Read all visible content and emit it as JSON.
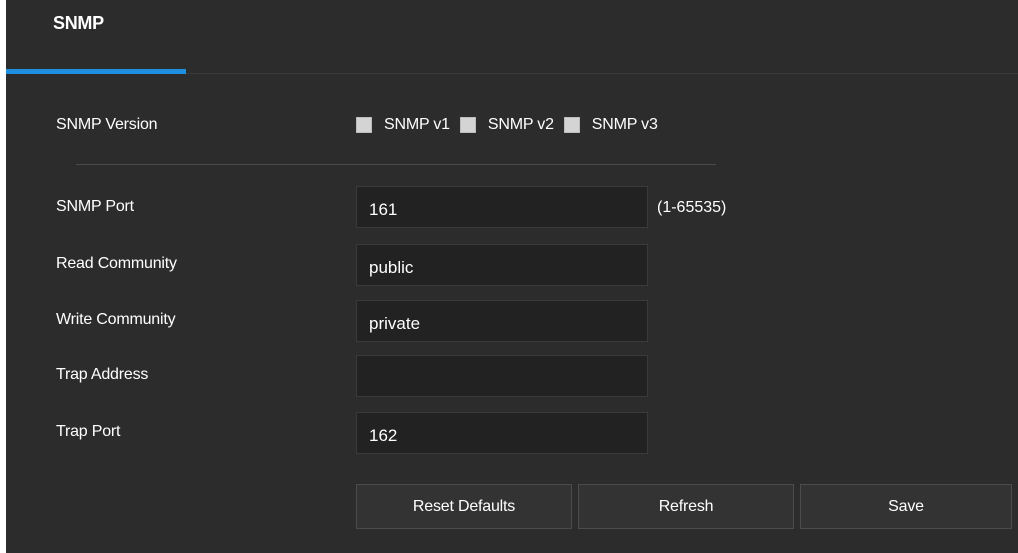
{
  "tabs": [
    {
      "label": "SNMP",
      "active": true
    }
  ],
  "colors": {
    "background": "#2c2c2c",
    "accent": "#1f8fe0",
    "input_bg": "#222222",
    "button_bg": "#333333",
    "checkbox": "#d4d4d4"
  },
  "form": {
    "version": {
      "label": "SNMP Version",
      "options": [
        {
          "label": "SNMP v1",
          "checked": false
        },
        {
          "label": "SNMP v2",
          "checked": false
        },
        {
          "label": "SNMP v3",
          "checked": false
        }
      ]
    },
    "port": {
      "label": "SNMP Port",
      "value": "161",
      "hint": "(1-65535)"
    },
    "read_community": {
      "label": "Read Community",
      "value": "public"
    },
    "write_community": {
      "label": "Write Community",
      "value": "private"
    },
    "trap_address": {
      "label": "Trap Address",
      "value": ""
    },
    "trap_port": {
      "label": "Trap Port",
      "value": "162"
    }
  },
  "buttons": {
    "reset": "Reset Defaults",
    "refresh": "Refresh",
    "save": "Save"
  }
}
